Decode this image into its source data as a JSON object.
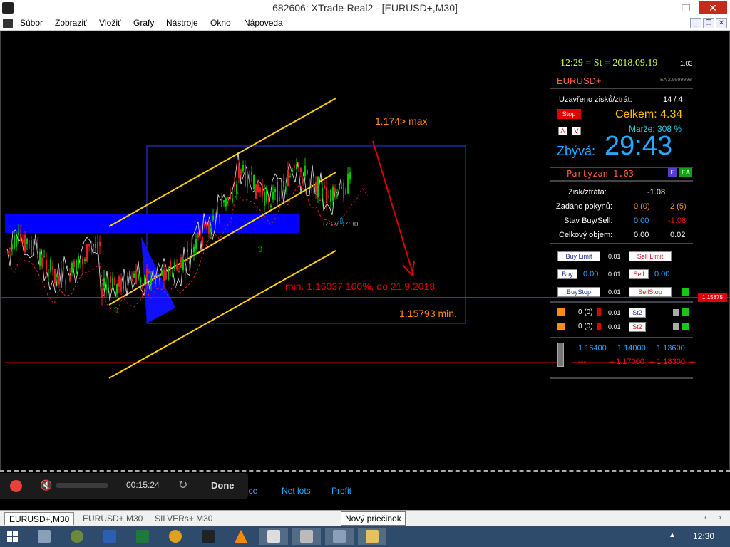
{
  "window": {
    "title": "682606: XTrade-Real2 - [EURUSD+,M30]"
  },
  "menu": {
    "items": [
      "Súbor",
      "Zobraziť",
      "Vložiť",
      "Grafy",
      "Nástroje",
      "Okno",
      "Nápoveda"
    ]
  },
  "chart": {
    "label_max": "1.174> max",
    "label_min_target": "min. 1,16037  100%, do 21.9.2018",
    "label_min": "1.15793 min.",
    "label_rs": "RS v 07:30",
    "price_marker": "1.15875"
  },
  "panel": {
    "clock": "12:29 = St = 2018.09.19",
    "version_small": "1.03",
    "symbol": "EURUSD+",
    "ea_tag": "EA 2.9999998",
    "closed_label": "Uzavřeno zisků/ztrát:",
    "closed_value": "14 / 4",
    "stop_button": "Stop",
    "total_label": "Celkem: 4.34",
    "arrow_up": "Λ",
    "arrow_down": "V",
    "margin_label": "Marže: 308 %",
    "remaining_label": "Zbývá:",
    "remaining_value": "29:43",
    "author": "Partyzan 1.03",
    "e_btn": "E",
    "ea_btn": "EA",
    "pl_label": "Zisk/ztráta:",
    "pl_value": "-1.08",
    "orders_label": "Zadáno pokynů:",
    "orders_buy": "0 (0)",
    "orders_sell": "2 (5)",
    "state_label": "Stav Buy/Sell:",
    "state_buy": "0.00",
    "state_sell": "-1.08",
    "volume_label": "Celkový objem:",
    "volume_buy": "0.00",
    "volume_sell": "0.02",
    "buy_limit": "Buy Limit",
    "buy_limit_lot": "0.01",
    "sell_limit": "Sell Limit",
    "buy": "Buy",
    "buy_value": "0.00",
    "buy_lot": "0.01",
    "sell": "Sell",
    "sell_value": "0.00",
    "buy_stop": "BuyStop",
    "buy_stop_lot": "0.01",
    "sell_stop": "SellStop",
    "row1_count": "0 (0)",
    "row1_lot": "0.01",
    "row1_btn": "St2",
    "row2_count": "0 (0)",
    "row2_lot": "0.01",
    "row2_btn": "St2",
    "level_blue_1": "1.16400",
    "level_blue_2": "1.14000",
    "level_blue_3": "1.13600",
    "level_red_dash": "---",
    "level_red_1": "– 1.17000",
    "level_red_2": "– 1.18300",
    "level_red_end": "–"
  },
  "terminal": {
    "col_ice": "ice",
    "col_netlots": "Net lots",
    "col_profit": "Profit"
  },
  "recorder": {
    "time": "00:15:24",
    "done": "Done"
  },
  "tabs": [
    "EURUSD+,M30",
    "EURUSD+,M30",
    "SILVERs+,M30"
  ],
  "tooltip": "Nový priečinok",
  "taskbar": {
    "clock": "12:30"
  },
  "colors": {
    "up_candle": "#00c800",
    "down_candle": "#e02020",
    "channel": "#ffd200",
    "blue_zone": "#0000ff",
    "panel_accent": "#29a8ff",
    "red_line": "#e00000"
  }
}
